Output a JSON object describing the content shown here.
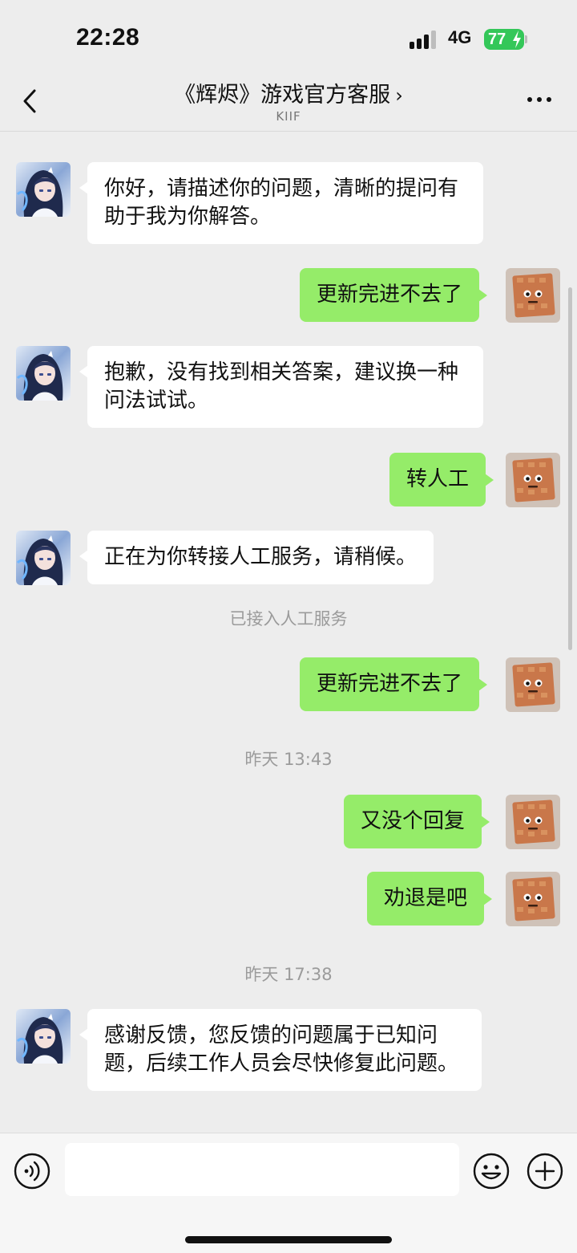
{
  "status_bar": {
    "time": "22:28",
    "network": "4G",
    "battery": "77"
  },
  "nav": {
    "title": "《辉烬》游戏官方客服",
    "chevron": "›",
    "subtitle": "KIIF"
  },
  "messages": [
    {
      "side": "in",
      "text": "你好，请描述你的问题，清晰的提问有助于我为你解答。"
    },
    {
      "side": "out",
      "text": "更新完进不去了"
    },
    {
      "side": "in",
      "text": "抱歉，没有找到相关答案，建议换一种问法试试。"
    },
    {
      "side": "out",
      "text": "转人工"
    },
    {
      "side": "in",
      "text": "正在为你转接人工服务，请稍候。"
    },
    {
      "side": "system",
      "text": "已接入人工服务"
    },
    {
      "side": "out",
      "text": "更新完进不去了"
    },
    {
      "side": "system",
      "text": "昨天 13:43"
    },
    {
      "side": "out",
      "text": "又没个回复"
    },
    {
      "side": "out",
      "text": "劝退是吧"
    },
    {
      "side": "system",
      "text": "昨天 17:38"
    },
    {
      "side": "in",
      "text": "感谢反馈，您反馈的问题属于已知问题，后续工作人员会尽快修复此问题。"
    }
  ],
  "input": {
    "value": "",
    "placeholder": ""
  },
  "colors": {
    "background": "#ededed",
    "outgoing_bubble": "#95ec69",
    "incoming_bubble": "#ffffff",
    "battery": "#34c759"
  },
  "icons": [
    "back-icon",
    "more-icon",
    "voice-icon",
    "emoji-icon",
    "plus-icon"
  ]
}
